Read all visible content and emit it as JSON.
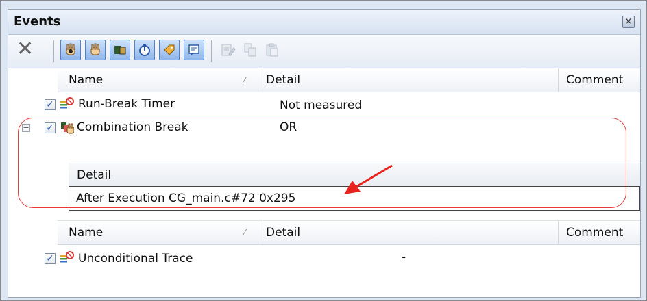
{
  "window": {
    "title": "Events",
    "close_label": "×"
  },
  "toolbar": {
    "buttons": [
      {
        "name": "delete",
        "icon": "delete-icon",
        "state": "enabled"
      },
      {
        "name": "hardware-break",
        "icon": "hand-icon",
        "state": "toggled"
      },
      {
        "name": "software-break",
        "icon": "hand-outline-icon",
        "state": "toggled"
      },
      {
        "name": "trace",
        "icon": "trace-icon",
        "state": "toggled"
      },
      {
        "name": "timer",
        "icon": "stopwatch-icon",
        "state": "toggled"
      },
      {
        "name": "action",
        "icon": "tag-icon",
        "state": "toggled"
      },
      {
        "name": "comment",
        "icon": "note-icon",
        "state": "toggled"
      },
      {
        "name": "edit-condition",
        "icon": "edit-icon",
        "state": "disabled"
      },
      {
        "name": "copy-condition",
        "icon": "copy-icon",
        "state": "disabled"
      },
      {
        "name": "paste-condition",
        "icon": "paste-icon",
        "state": "disabled"
      }
    ]
  },
  "table": {
    "columns": {
      "name": "Name",
      "detail": "Detail",
      "comment": "Comment",
      "sort_glyph": "⁄"
    },
    "rows": [
      {
        "checked": true,
        "icon": "timer-event-icon",
        "name": "Run-Break Timer",
        "detail": "Not measured"
      },
      {
        "checked": true,
        "icon": "combination-break-icon",
        "name": "Combination Break",
        "detail": "OR",
        "expanded": true,
        "sub": {
          "header": "Detail",
          "value": "After Execution  CG_main.c#72 0x295"
        }
      }
    ],
    "rows2": [
      {
        "checked": true,
        "icon": "trace-event-icon",
        "name": "Unconditional Trace",
        "detail": "-"
      }
    ]
  },
  "colors": {
    "accent": "#4f82c9",
    "highlight": "#e23b3b",
    "arrow": "#e8231d"
  }
}
